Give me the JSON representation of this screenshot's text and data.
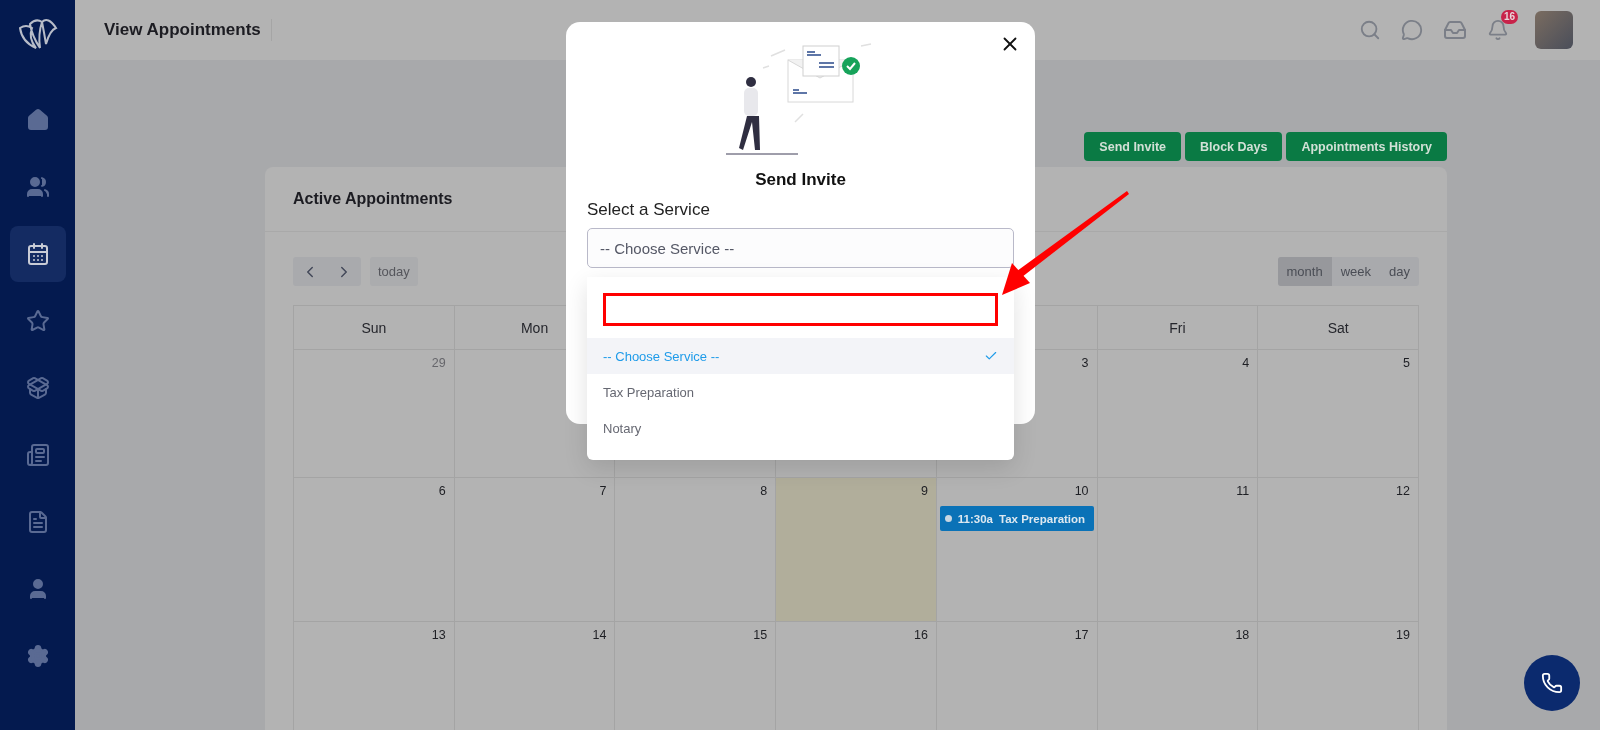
{
  "sidebar": {
    "items": [
      {
        "kind": "home",
        "selected": false
      },
      {
        "kind": "users",
        "selected": false
      },
      {
        "kind": "calendar",
        "selected": true
      },
      {
        "kind": "star",
        "selected": false
      },
      {
        "kind": "box",
        "selected": false
      },
      {
        "kind": "list",
        "selected": false
      },
      {
        "kind": "document",
        "selected": false
      },
      {
        "kind": "user",
        "selected": false
      },
      {
        "kind": "settings",
        "selected": false
      }
    ]
  },
  "header": {
    "title": "View Appointments",
    "notification_count": "16"
  },
  "actions": [
    "Send Invite",
    "Block Days",
    "Appointments History"
  ],
  "card": {
    "title": "Active Appointments",
    "today_button": "today",
    "views": [
      {
        "label": "month",
        "selected": true
      },
      {
        "label": "week",
        "selected": false
      },
      {
        "label": "day",
        "selected": false
      }
    ],
    "weekdays": {
      "before_dropdown": [
        "Sun",
        "Mon"
      ],
      "after_dropdown": [
        "Fri",
        "Sat"
      ]
    },
    "weeks": [
      {
        "before_dropdown": [
          {
            "day": "29",
            "muted": true,
            "today": false
          }
        ],
        "after_dropdown": [
          {
            "day": "3",
            "muted": false,
            "today": false
          },
          {
            "day": "4",
            "muted": false,
            "today": false
          },
          {
            "day": "5",
            "muted": false,
            "today": false
          }
        ]
      },
      [
        {
          "day": "6",
          "muted": false,
          "today": false
        },
        {
          "day": "7",
          "muted": false,
          "today": false
        },
        {
          "day": "8",
          "muted": false,
          "today": false
        },
        {
          "day": "9",
          "muted": false,
          "today": true
        },
        {
          "day": "10",
          "muted": false,
          "today": false,
          "events": [
            {
              "time": "11:30a",
              "title": "Tax Preparation"
            }
          ]
        },
        {
          "day": "11",
          "muted": false,
          "today": false
        },
        {
          "day": "12",
          "muted": false,
          "today": false
        }
      ],
      [
        {
          "day": "13",
          "muted": false,
          "today": false
        },
        {
          "day": "14",
          "muted": false,
          "today": false
        },
        {
          "day": "15",
          "muted": false,
          "today": false
        },
        {
          "day": "16",
          "muted": false,
          "today": false
        },
        {
          "day": "17",
          "muted": false,
          "today": false
        },
        {
          "day": "18",
          "muted": false,
          "today": false
        },
        {
          "day": "19",
          "muted": false,
          "today": false
        }
      ]
    ]
  },
  "modal": {
    "title": "Send Invite",
    "label": "Select a Service",
    "select_value": "-- Choose Service --",
    "options": [
      {
        "label": "-- Choose Service --",
        "selected": true
      },
      {
        "label": "Tax Preparation",
        "selected": false
      },
      {
        "label": "Notary",
        "selected": false
      }
    ]
  }
}
